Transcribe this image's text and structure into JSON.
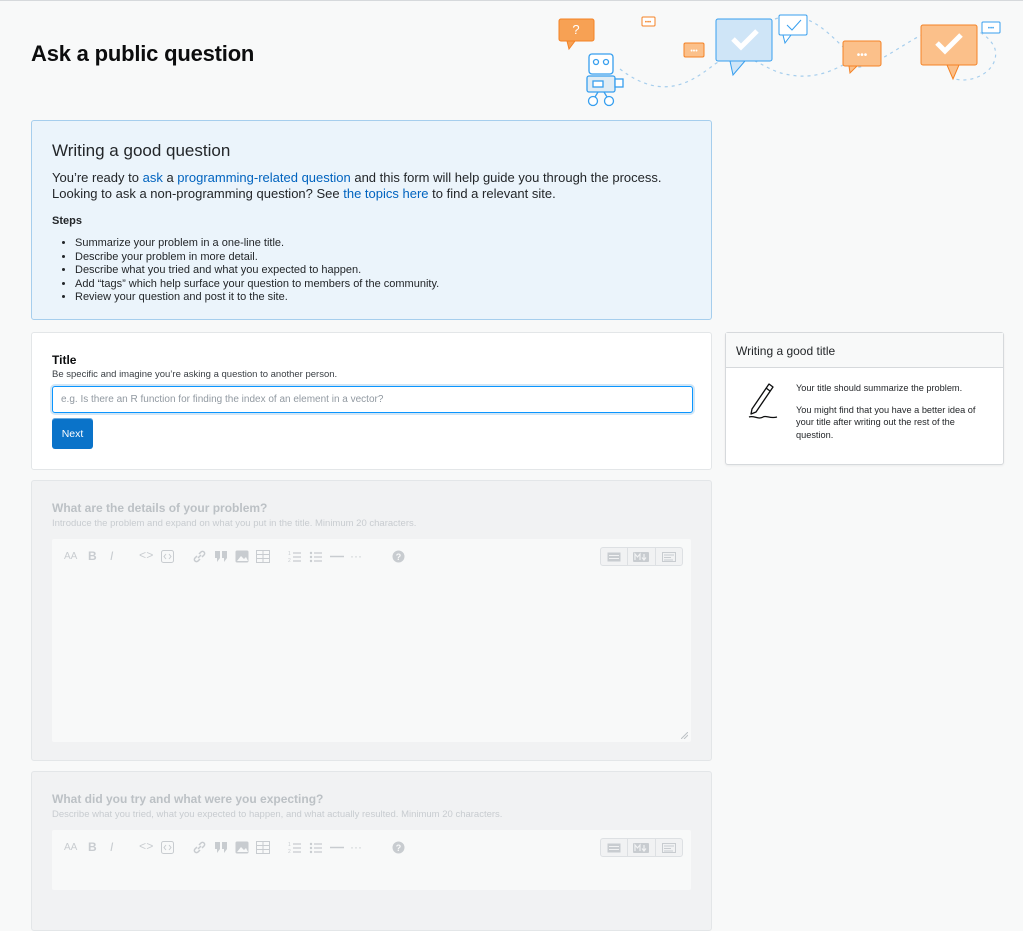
{
  "page": {
    "title": "Ask a public question"
  },
  "notice": {
    "heading": "Writing a good question",
    "line1_pre": "You’re ready to ",
    "line1_link1": "ask",
    "line1_mid": " a ",
    "line1_link2": "programming-related question",
    "line1_post": " and this form will help guide you through the process.",
    "line2_pre": "Looking to ask a non-programming question? See ",
    "line2_link": "the topics here",
    "line2_post": " to find a relevant site.",
    "steps_title": "Steps",
    "steps": [
      "Summarize your problem in a one-line title.",
      "Describe your problem in more detail.",
      "Describe what you tried and what you expected to happen.",
      "Add “tags” which help surface your question to members of the community.",
      "Review your question and post it to the site."
    ]
  },
  "title_field": {
    "label": "Title",
    "description": "Be specific and imagine you’re asking a question to another person.",
    "value": "",
    "placeholder": "e.g. Is there an R function for finding the index of an element in a vector?",
    "next_label": "Next"
  },
  "sidebar": {
    "heading": "Writing a good title",
    "text1": "Your title should summarize the problem.",
    "text2": "You might find that you have a better idea of your title after writing out the rest of the question.",
    "icon": "pencil-icon"
  },
  "details_field": {
    "label": "What are the details of your problem?",
    "description": "Introduce the problem and expand on what you put in the title. Minimum 20 characters."
  },
  "tried_field": {
    "label": "What did you try and what were you expecting?",
    "description": "Describe what you tried, what you expected to happen, and what actually resulted. Minimum 20 characters."
  },
  "toolbar": {
    "icons": [
      "text-size-icon",
      "bold-icon",
      "italic-icon",
      "code-icon",
      "code-block-icon",
      "link-icon",
      "quote-icon",
      "image-icon",
      "table-icon",
      "ordered-list-icon",
      "unordered-list-icon",
      "horizontal-rule-icon",
      "more-icon",
      "help-icon"
    ],
    "modes": [
      "rich-text-mode-icon",
      "markdown-mode-icon",
      "preview-mode-icon"
    ],
    "bold_glyph": "B",
    "italic_glyph": "I",
    "code_glyph": "<>",
    "more_glyph": "···",
    "help_glyph": "?",
    "text_size_glyph": "AA"
  },
  "colors": {
    "accent": "#0a73c9",
    "link": "#0063bf",
    "notice_bg": "#ebf4fb",
    "notice_border": "#a6ceed",
    "illustration_orange": "#f48225",
    "illustration_blue": "#379fef"
  }
}
